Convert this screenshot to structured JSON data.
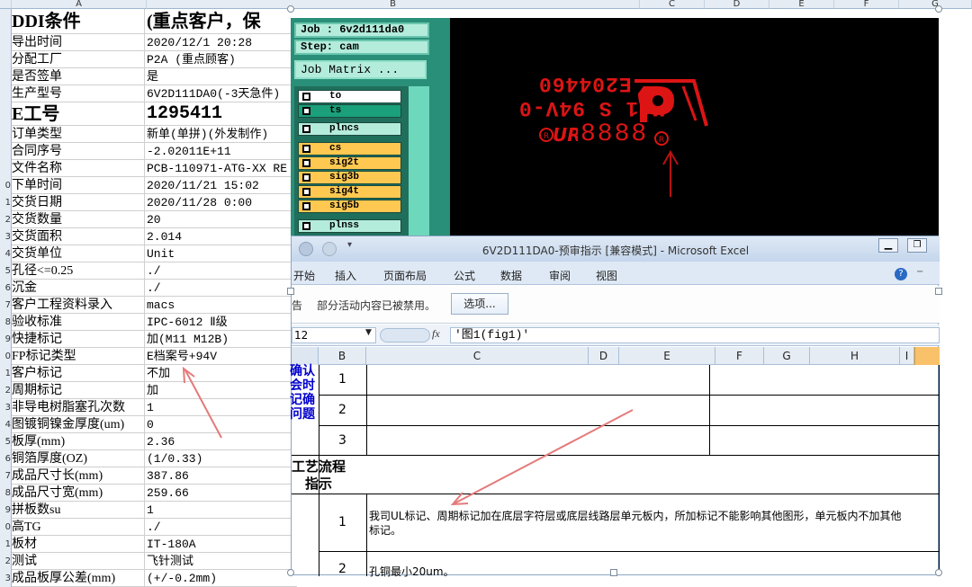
{
  "bg_sheet": {
    "col_headers": [
      "A",
      "B",
      "C",
      "D",
      "E",
      "F",
      "G"
    ],
    "header_row": {
      "a": "DDI条件",
      "b": "(重点客户，保"
    },
    "rows": [
      {
        "num": "",
        "label": "导出时间",
        "value": "2020/12/1 20:28"
      },
      {
        "num": "",
        "label": "分配工厂",
        "value": "P2A (重点顾客)"
      },
      {
        "num": "",
        "label": "是否签单",
        "value": "是"
      },
      {
        "num": "",
        "label": "生产型号",
        "value": "6V2D111DA0(-3天急件)"
      },
      {
        "num": "",
        "label": "E工号",
        "value": "1295411",
        "big": true
      },
      {
        "num": "",
        "label": "订单类型",
        "value": "新单(单拼)(外发制作)"
      },
      {
        "num": "",
        "label": "合同序号",
        "value": "-2.02011E+11"
      },
      {
        "num": "",
        "label": "文件名称",
        "value": "PCB-110971-ATG-XX RE"
      },
      {
        "num": "0",
        "label": "下单时间",
        "value": "2020/11/21 15:02"
      },
      {
        "num": "1",
        "label": "交货日期",
        "value": "2020/11/28 0:00"
      },
      {
        "num": "2",
        "label": "交货数量",
        "value": "20"
      },
      {
        "num": "3",
        "label": "交货面积",
        "value": "2.014"
      },
      {
        "num": "4",
        "label": "交货单位",
        "value": "Unit"
      },
      {
        "num": "5",
        "label": "孔径<=0.25",
        "value": "./"
      },
      {
        "num": "6",
        "label": "沉金",
        "value": "./"
      },
      {
        "num": "7",
        "label": "客户工程资料录入",
        "value": "macs"
      },
      {
        "num": "8",
        "label": "验收标准",
        "value": "IPC-6012 Ⅱ级"
      },
      {
        "num": "9",
        "label": "快捷标记",
        "value": "加(M11 M12B)"
      },
      {
        "num": "0",
        "label": "FP标记类型",
        "value": "E档案号+94V"
      },
      {
        "num": "1",
        "label": "客户标记",
        "value": "不加"
      },
      {
        "num": "2",
        "label": "周期标记",
        "value": "加"
      },
      {
        "num": "3",
        "label": "非导电树脂塞孔次数",
        "value": "1"
      },
      {
        "num": "4",
        "label": "图镀铜镍金厚度(um)",
        "value": "0"
      },
      {
        "num": "5",
        "label": "板厚(mm)",
        "value": "2.36"
      },
      {
        "num": "6",
        "label": "铜箔厚度(OZ)",
        "value": "(1/0.33)"
      },
      {
        "num": "7",
        "label": "成品尺寸长(mm)",
        "value": "387.86"
      },
      {
        "num": "8",
        "label": "成品尺寸宽(mm)",
        "value": "259.66"
      },
      {
        "num": "9",
        "label": "拼板数su",
        "value": "1"
      },
      {
        "num": "0",
        "label": "高TG",
        "value": "./"
      },
      {
        "num": "1",
        "label": "板材",
        "value": "IT-180A"
      },
      {
        "num": "2",
        "label": "测试",
        "value": "飞针测试"
      },
      {
        "num": "3",
        "label": "成品板厚公差(mm)",
        "value": "(+/-0.2mm)"
      }
    ]
  },
  "cam": {
    "job_label": "Job : 6v2d111da0",
    "step_label": "Step: cam",
    "job_matrix_button": "Job Matrix ...",
    "layers": [
      {
        "name": "to",
        "color": "#ffffff"
      },
      {
        "name": "ts",
        "color": "#1aa07a"
      },
      {
        "name": "plncs",
        "color": "#b4ecdc"
      },
      {
        "name": "cs",
        "color": "#ffc850"
      },
      {
        "name": "sig2t",
        "color": "#ffc850"
      },
      {
        "name": "sig3b",
        "color": "#ffc850"
      },
      {
        "name": "sig4t",
        "color": "#ffc850"
      },
      {
        "name": "sig5b",
        "color": "#ffc850"
      },
      {
        "name": "plnss",
        "color": "#b4ecdc"
      }
    ],
    "marking_text_1": "E204460",
    "marking_text_2": "M11 S 94V-0",
    "marking_text_3": "8888",
    "marking_color": "#dd1414"
  },
  "excel": {
    "title": "6V2D111DA0-预审指示 [兼容模式] - Microsoft Excel",
    "ribbon_tabs": [
      "开始",
      "插入",
      "页面布局",
      "公式",
      "数据",
      "审阅",
      "视图"
    ],
    "security_label": "告",
    "security_message": "部分活动内容已被禁用。",
    "options_button": "选项...",
    "name_box": "12",
    "fx_label": "fx",
    "formula": "'图1(fig1)'",
    "col_headers": [
      "B",
      "C",
      "D",
      "E",
      "F",
      "G",
      "H",
      "I"
    ],
    "side_text_1": "确认\n会时\n记确\n问题",
    "rows_top": [
      "1",
      "2",
      "3"
    ],
    "process_title": "工艺流程\n指示",
    "instr_num_1": "1",
    "instr_text_1": "我司UL标记、周期标记加在底层字符层或底层线路层单元板内，所加标记不能影响其他图形，单元板内不加其他标记。",
    "instr_num_2": "2",
    "instr_text_2": "孔铜最小20um。"
  }
}
